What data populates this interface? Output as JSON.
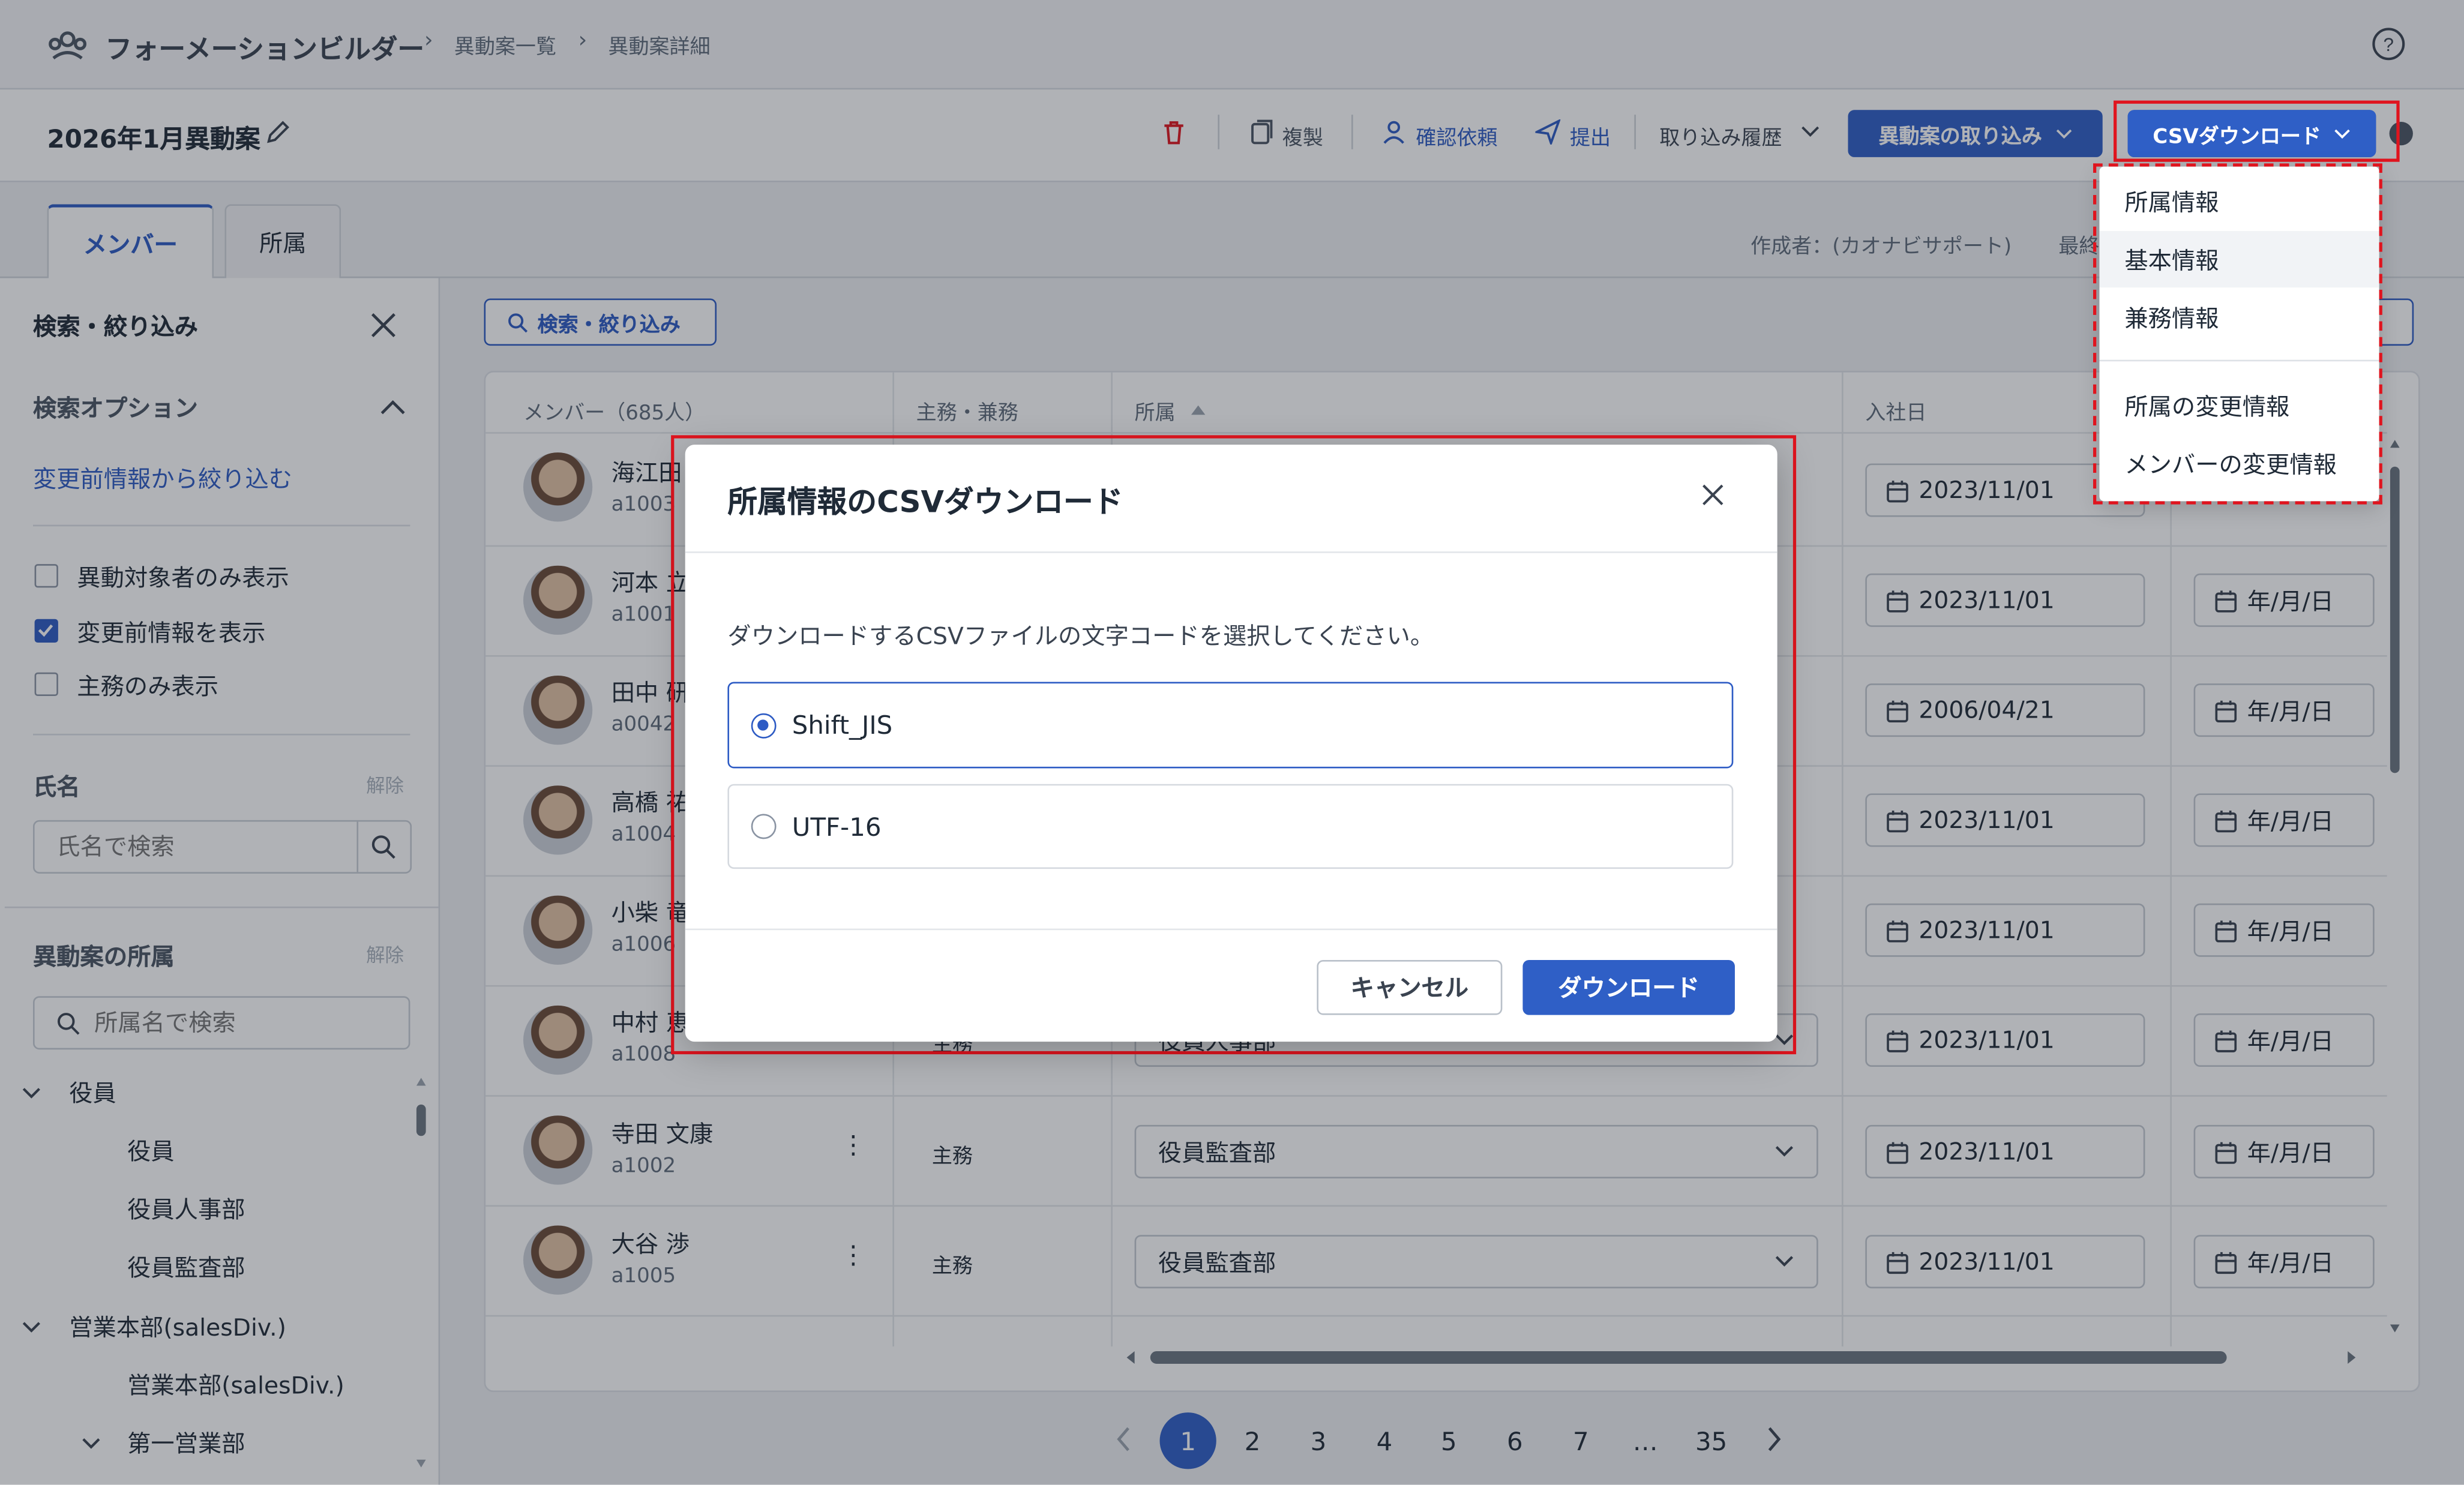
{
  "header": {
    "app_name": "フォーメーションビルダー",
    "breadcrumb": [
      "異動案一覧",
      "異動案詳細"
    ]
  },
  "titlebar": {
    "title": "2026年1月異動案",
    "actions": {
      "copy": "複製",
      "confirm_request": "確認依頼",
      "submit": "提出",
      "import_history": "取り込み履歴",
      "import": "異動案の取り込み",
      "csv_download": "CSVダウンロード"
    }
  },
  "csv_menu": {
    "items": [
      "所属情報",
      "基本情報",
      "兼務情報",
      "所属の変更情報",
      "メンバーの変更情報"
    ]
  },
  "tabs": [
    "メンバー",
    "所属"
  ],
  "meta": {
    "created_by": "作成者：(カオナビサポート)",
    "last_truncated": "最終"
  },
  "sidebar": {
    "title": "検索・絞り込み",
    "options_title": "検索オプション",
    "filter_link": "変更前情報から絞り込む",
    "checkboxes": [
      {
        "label": "異動対象者のみ表示",
        "checked": false
      },
      {
        "label": "変更前情報を表示",
        "checked": true
      },
      {
        "label": "主務のみ表示",
        "checked": false
      }
    ],
    "name_section": {
      "title": "氏名",
      "clear": "解除",
      "placeholder": "氏名で検索"
    },
    "dept_section": {
      "title": "異動案の所属",
      "clear": "解除",
      "placeholder": "所属名で検索"
    },
    "tree": [
      {
        "label": "役員",
        "level": 0,
        "expanded": true
      },
      {
        "label": "役員",
        "level": 1
      },
      {
        "label": "役員人事部",
        "level": 1
      },
      {
        "label": "役員監査部",
        "level": 1
      },
      {
        "label": "営業本部(salesDiv.)",
        "level": 0,
        "expanded": true
      },
      {
        "label": "営業本部(salesDiv.)",
        "level": 1
      },
      {
        "label": "第一営業部",
        "level": 1,
        "expanded": true
      }
    ]
  },
  "main": {
    "search_button": "検索・絞り込み",
    "columns": {
      "member": "メンバー（685人）",
      "role": "主務・兼務",
      "dept": "所属",
      "hire_date": "入社日"
    },
    "rows": [
      {
        "name": "海江田",
        "id": "a1003",
        "role": "",
        "dept": "",
        "hire": "2023/11/01",
        "date2": ""
      },
      {
        "name": "河本 立",
        "id": "a1001",
        "role": "",
        "dept": "",
        "hire": "2023/11/01",
        "date2": "年/月/日"
      },
      {
        "name": "田中 研",
        "id": "a0042",
        "role": "",
        "dept": "",
        "hire": "2006/04/21",
        "date2": "年/月/日"
      },
      {
        "name": "高橋 祐",
        "id": "a1004",
        "role": "",
        "dept": "",
        "hire": "2023/11/01",
        "date2": "年/月/日"
      },
      {
        "name": "小柴 竜",
        "id": "a1006",
        "role": "",
        "dept": "",
        "hire": "2023/11/01",
        "date2": "年/月/日"
      },
      {
        "name": "中村 恵",
        "id": "a1008",
        "role": "主務",
        "dept": "役員人事部",
        "hire": "2023/11/01",
        "date2": "年/月/日"
      },
      {
        "name": "寺田 文康",
        "id": "a1002",
        "role": "主務",
        "dept": "役員監査部",
        "hire": "2023/11/01",
        "date2": "年/月/日"
      },
      {
        "name": "大谷 渉",
        "id": "a1005",
        "role": "主務",
        "dept": "役員監査部",
        "hire": "2023/11/01",
        "date2": "年/月/日"
      }
    ]
  },
  "pagination": {
    "pages": [
      "1",
      "2",
      "3",
      "4",
      "5",
      "6",
      "7",
      "…",
      "35"
    ],
    "current": "1"
  },
  "modal": {
    "title": "所属情報のCSVダウンロード",
    "description": "ダウンロードするCSVファイルの文字コードを選択してください。",
    "options": [
      {
        "label": "Shift_JIS",
        "selected": true
      },
      {
        "label": "UTF-16",
        "selected": false
      }
    ],
    "cancel": "キャンセル",
    "download": "ダウンロード"
  },
  "colors": {
    "accent": "#2f5fc6",
    "highlight": "#e0141e"
  }
}
